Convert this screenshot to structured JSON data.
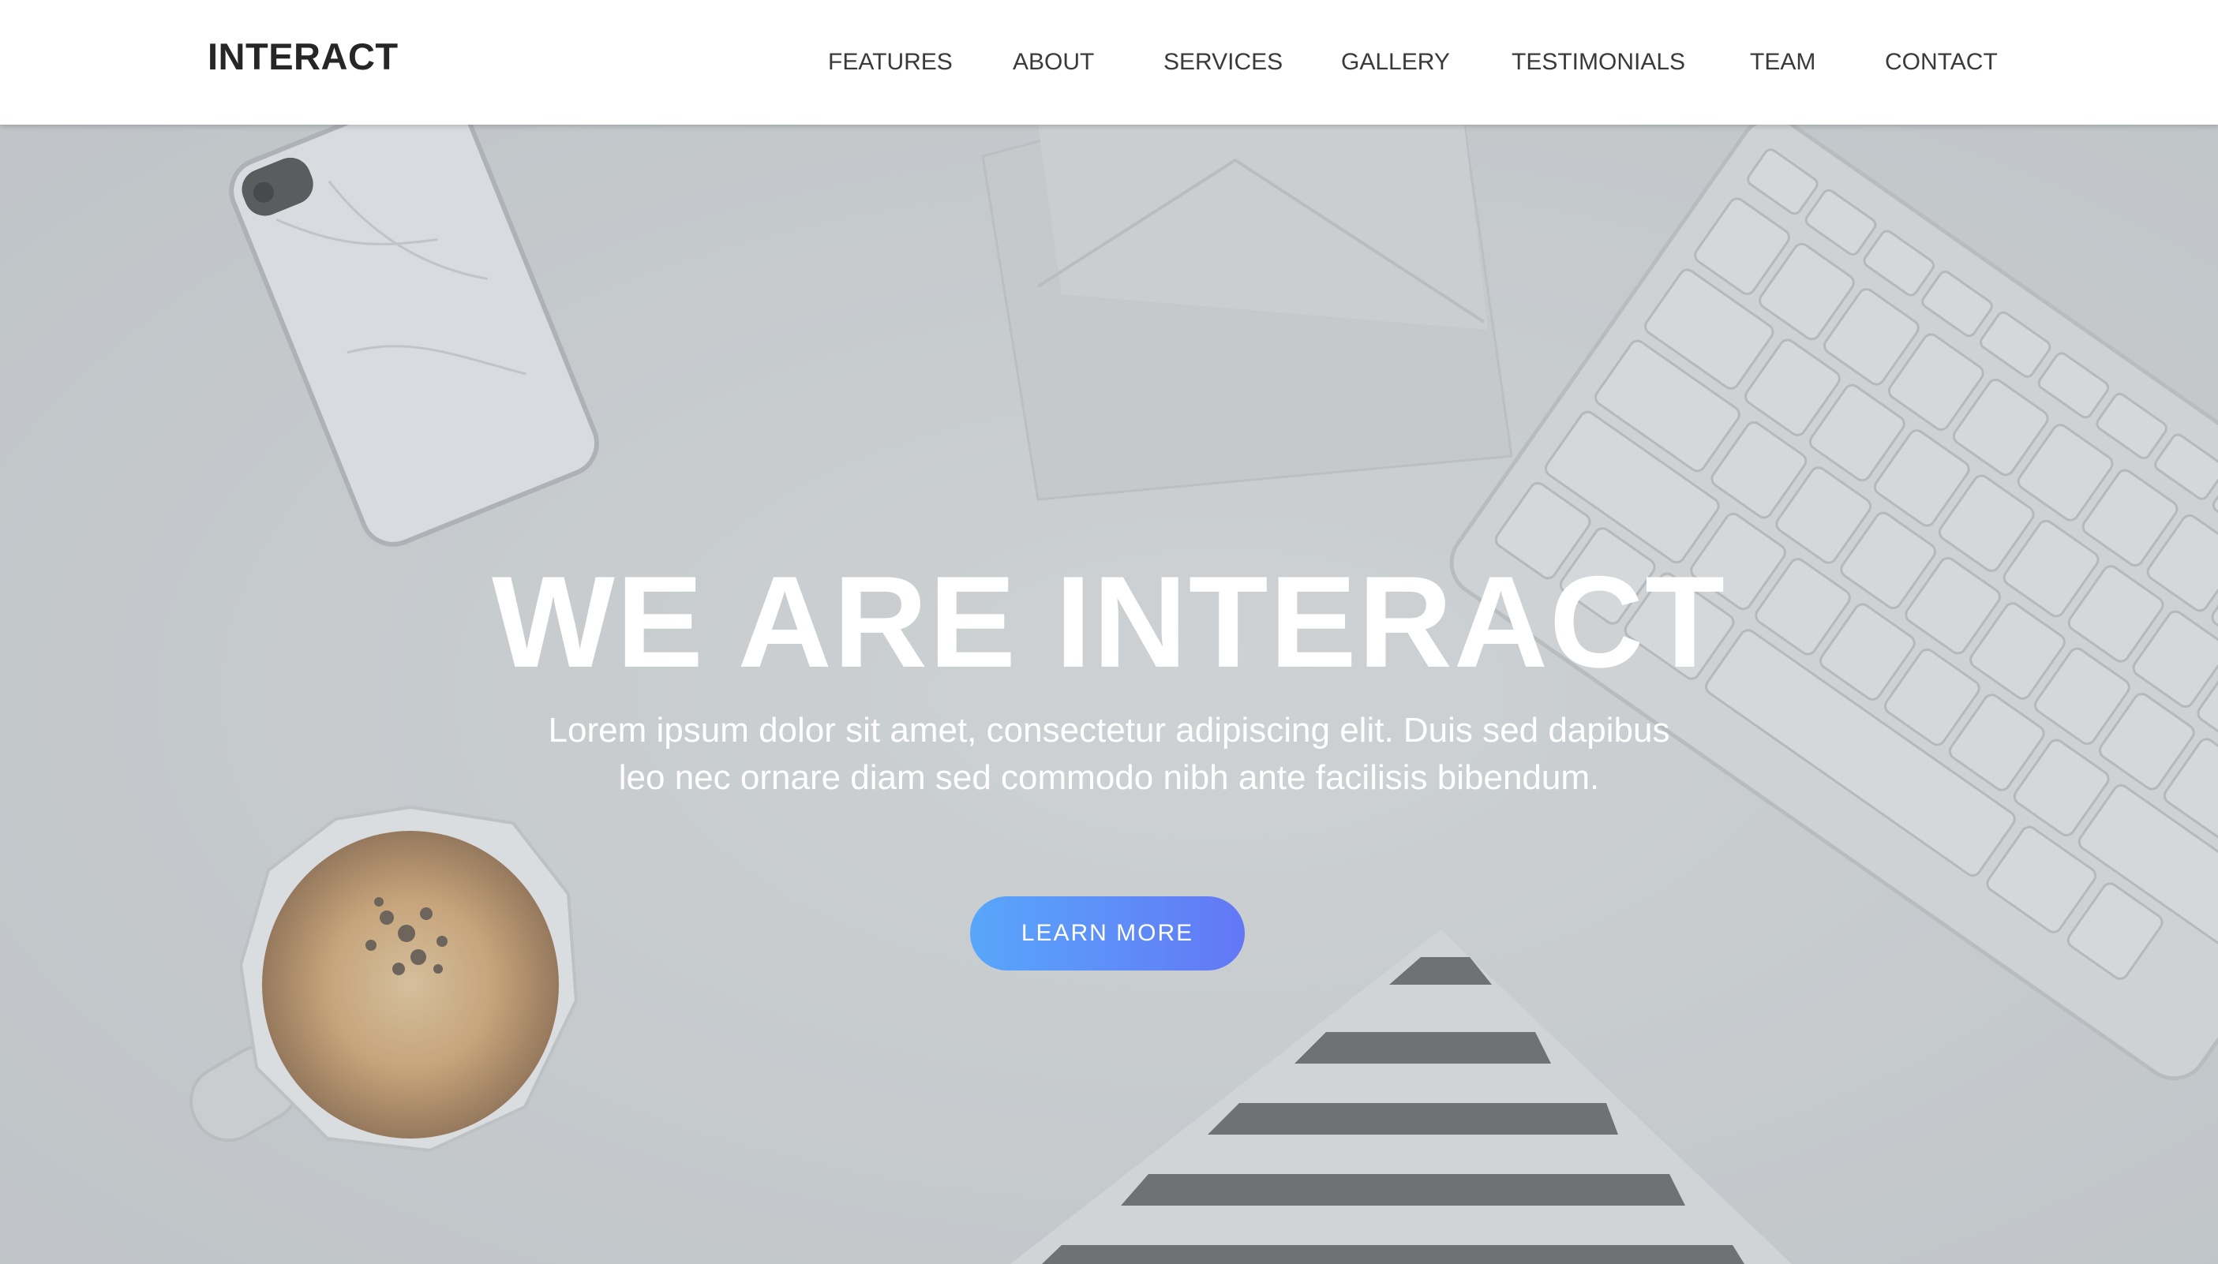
{
  "brand": "INTERACT",
  "nav": {
    "features": "FEATURES",
    "about": "ABOUT",
    "services": "SERVICES",
    "gallery": "GALLERY",
    "testimonials": "TESTIMONIALS",
    "team": "TEAM",
    "contact": "CONTACT"
  },
  "hero": {
    "title": "WE ARE INTERACT",
    "text_line1": "Lorem ipsum dolor sit amet, consectetur adipiscing elit. Duis sed dapibus",
    "text_line2": "leo nec ornare diam sed commodo nibh ante facilisis bibendum.",
    "cta_label": "LEARN MORE"
  },
  "colors": {
    "navbar_bg": "#ffffff",
    "brand_text": "#262626",
    "nav_text": "#3a3a3a",
    "hero_overlay": "#c6c9cc",
    "hero_text": "#ffffff",
    "cta_gradient_start": "#58a7fb",
    "cta_gradient_end": "#6377f5"
  },
  "icons": [
    "phone-icon",
    "envelope-icon",
    "keyboard-icon",
    "coffee-cup-icon",
    "striped-notebook-icon"
  ]
}
